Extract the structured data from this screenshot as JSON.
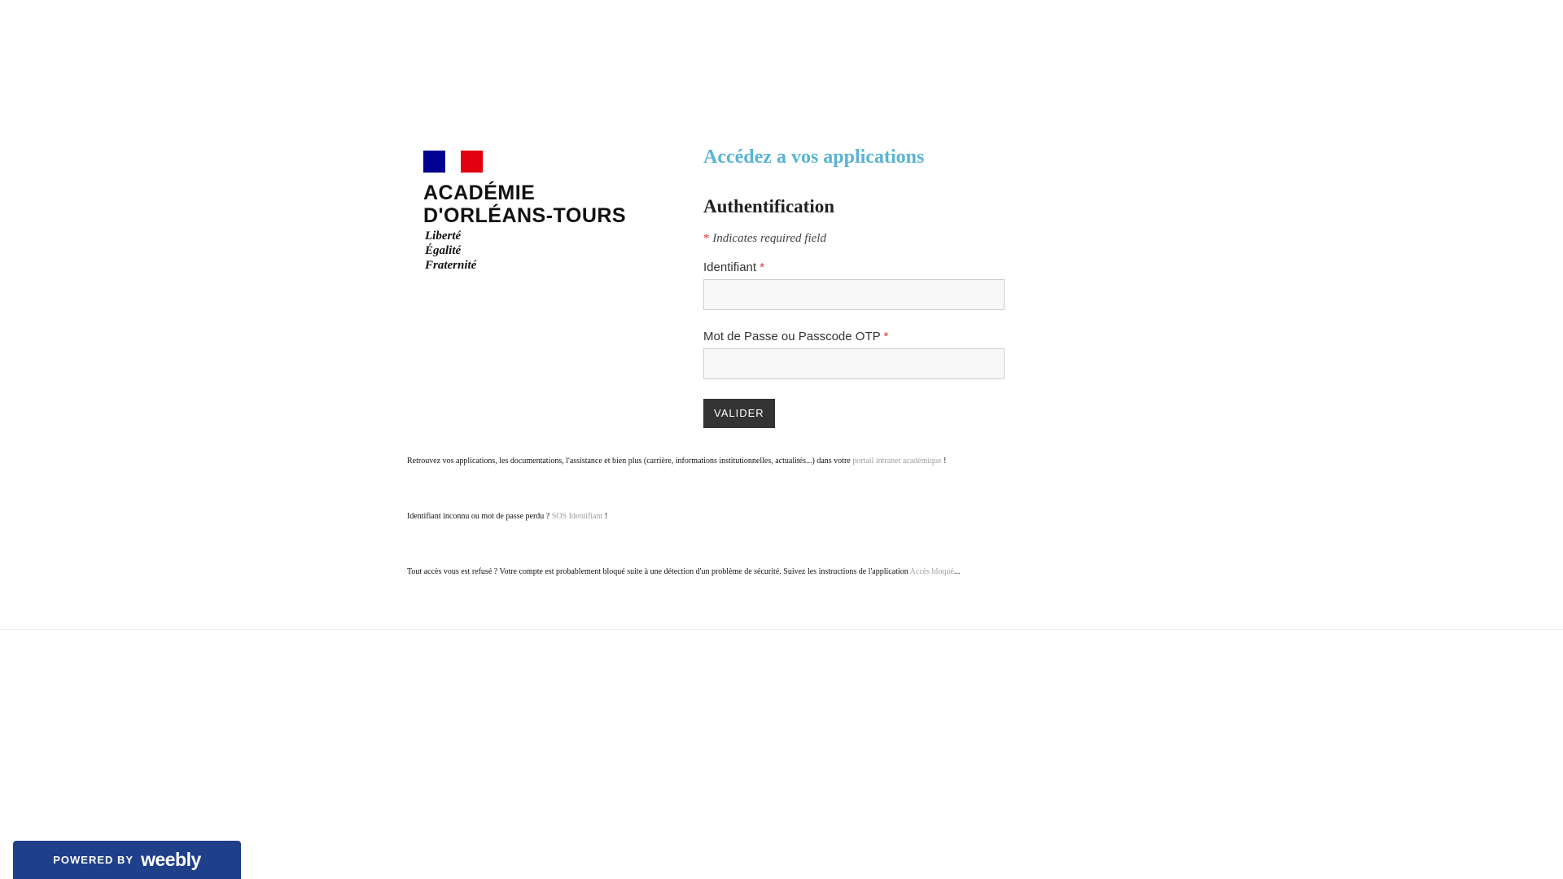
{
  "logo": {
    "line1": "ACADÉMIE",
    "line2": "D'ORLÉANS-TOURS",
    "motto1": "Liberté",
    "motto2": "Égalité",
    "motto3": "Fraternité",
    "flag_colors": [
      "#000091",
      "#ffffff",
      "#e1000f"
    ]
  },
  "form": {
    "headline": "Accédez a vos applications",
    "title": "Authentification",
    "required_star": "*",
    "required_note": "Indicates required field",
    "identifiant_label": "Identifiant",
    "identifiant_value": "",
    "password_label": "Mot de Passe ou Passcode OTP",
    "password_value": "",
    "submit_label": "VALIDER"
  },
  "info": {
    "line1_text": "Retrouvez vos applications, les documentations, l'assistance et bien plus (carrière, informations institutionnelles, actualités...) dans votre",
    "line1_link": "portail intranet académique",
    "line1_end": "!",
    "line2_text": "Identifiant inconnu ou mot de passe perdu ?",
    "line2_link": "SOS Identifiant",
    "line2_end": "!",
    "line3_text": "Tout accès vous est refusé ? Votre compte est probablement bloqué suite à une détection d'un problème de sécurité. Suivez les instructions de l'application",
    "line3_link": "Accès bloqué",
    "line3_end": "..."
  },
  "badge": {
    "powered": "POWERED BY",
    "brand": "weebly"
  },
  "colors": {
    "headline": "#5ab3d6",
    "button_bg": "#333333",
    "link": "#a0a0a0",
    "required": "#d33",
    "badge_bg": "#1f3f8b"
  }
}
